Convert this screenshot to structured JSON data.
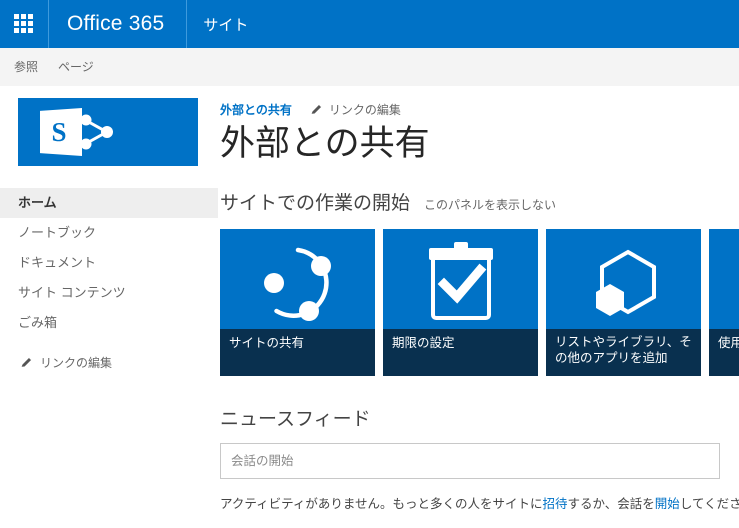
{
  "suite": {
    "waffle_icon": "app-launcher-grid-icon",
    "brand": "Office 365",
    "nav_link": "サイト"
  },
  "ribbon": {
    "tabs": [
      {
        "label": "参照"
      },
      {
        "label": "ページ"
      }
    ]
  },
  "sidebar": {
    "logo_letter": "S",
    "logo_icon": "sharepoint-share-icon",
    "items": [
      {
        "label": "ホーム",
        "selected": true
      },
      {
        "label": "ノートブック",
        "selected": false
      },
      {
        "label": "ドキュメント",
        "selected": false
      },
      {
        "label": "サイト コンテンツ",
        "selected": false
      },
      {
        "label": "ごみ箱",
        "selected": false
      }
    ],
    "edit_links": "リンクの編集",
    "edit_links_icon": "pencil-icon"
  },
  "main": {
    "breadcrumb": "外部との共有",
    "edit_links": "リンクの編集",
    "edit_links_icon": "pencil-icon",
    "title": "外部との共有",
    "get_started": {
      "heading": "サイトでの作業の開始",
      "hide_panel": "このパネルを表示しない",
      "tiles": [
        {
          "label": "サイトの共有",
          "icon": "share-network-icon"
        },
        {
          "label": "期限の設定",
          "icon": "clipboard-check-icon"
        },
        {
          "label": "リストやライブラリ、その他のアプリを追加",
          "icon": "hexagon-app-icon"
        },
        {
          "label": "使用す",
          "icon": "partial-tile-icon"
        }
      ]
    },
    "newsfeed": {
      "heading": "ニュースフィード",
      "input_placeholder": "会話の開始",
      "input_value": "",
      "empty_prefix": "アクティビティがありません。もっと多くの人をサイトに",
      "empty_link1": "招待",
      "empty_middle": "するか、会話を",
      "empty_link2": "開始",
      "empty_suffix": "してください。"
    }
  },
  "colors": {
    "brand_blue": "#0072c6",
    "tile_dark": "#09304f",
    "link_blue": "#0072c6",
    "ribbon_bg": "#f4f4f4",
    "nav_selected_bg": "#eeeeee"
  }
}
